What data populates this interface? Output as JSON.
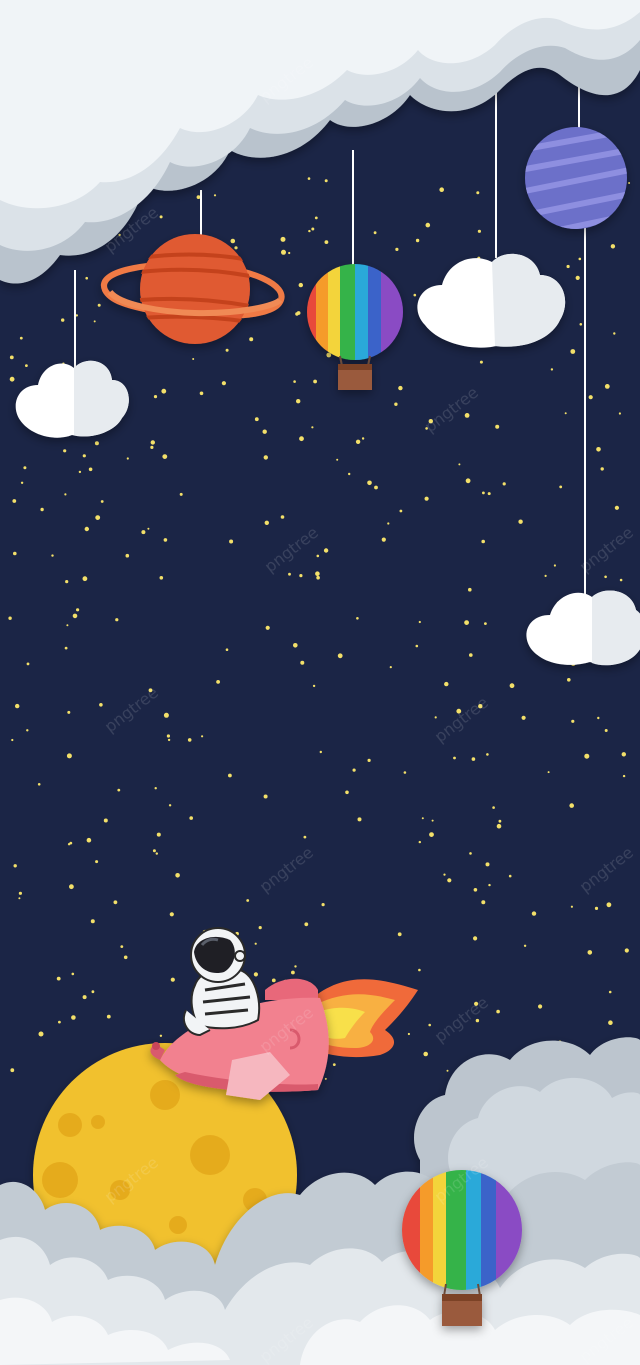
{
  "scene": {
    "background_color": "#1b2546",
    "star_color": "#f3e06a",
    "watermark_text": "pngtree",
    "objects": [
      "paper-cloud-top",
      "ringed-planet",
      "rainbow-hot-air-balloon",
      "hanging-paper-cloud",
      "purple-planet",
      "astronaut",
      "pink-rocket",
      "yellow-moon",
      "paper-cloud-bottom"
    ]
  }
}
